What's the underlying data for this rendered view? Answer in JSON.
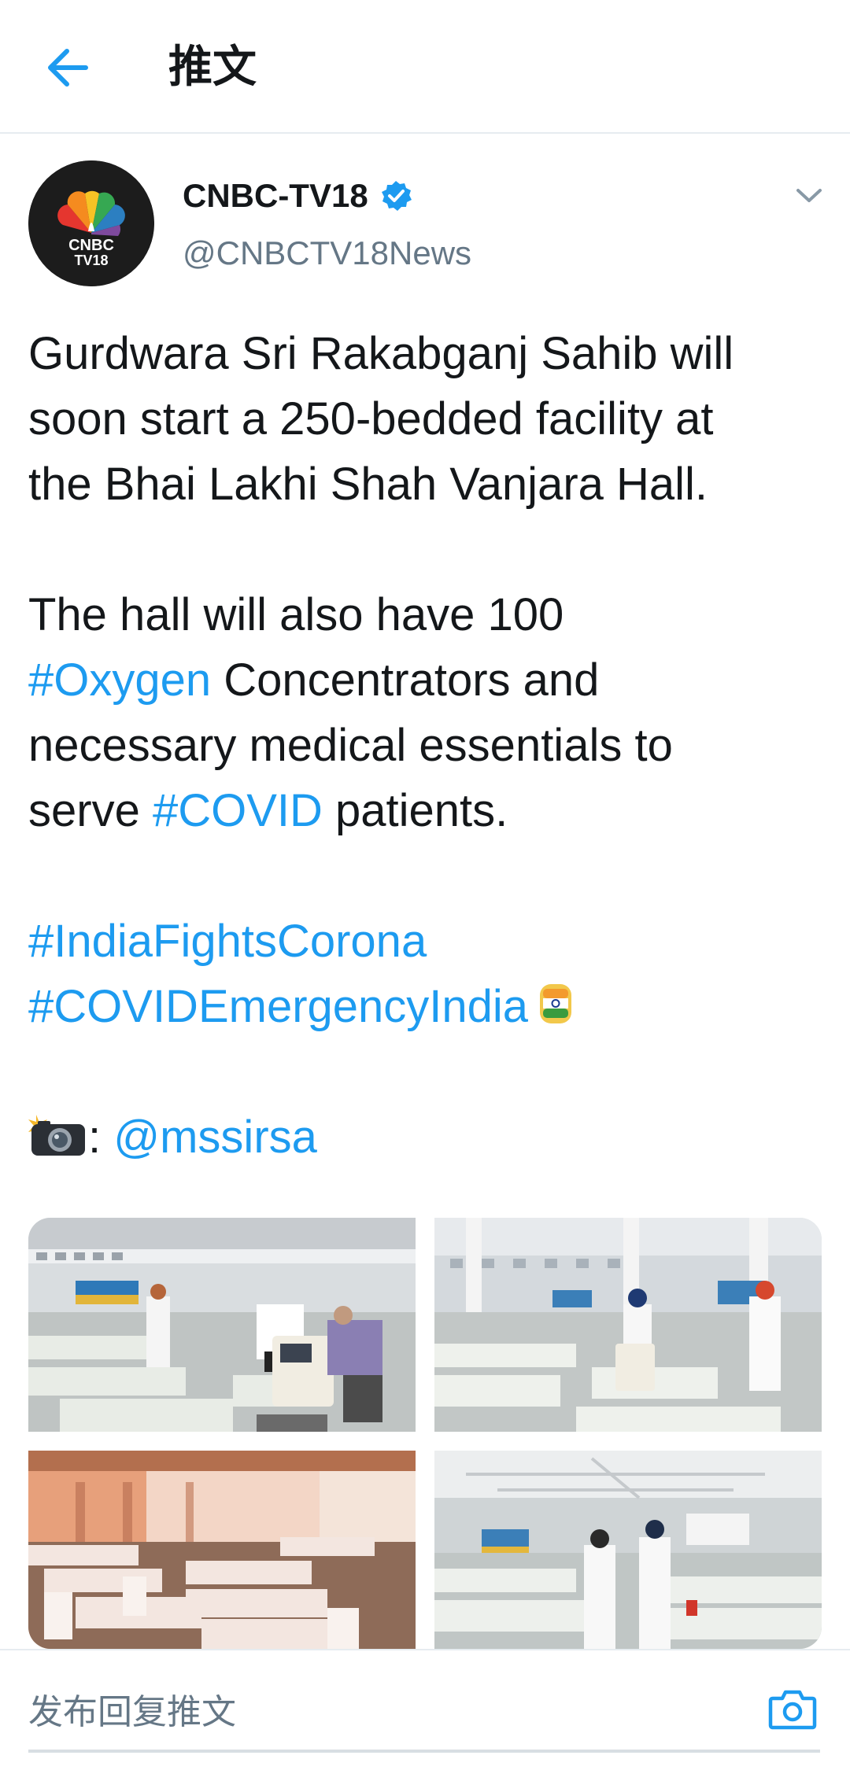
{
  "header": {
    "title": "推文"
  },
  "author": {
    "avatar_text_top": "CNBC",
    "avatar_text_bottom": "TV18",
    "name": "CNBC-TV18",
    "handle": "@CNBCTV18News",
    "verified": true
  },
  "tweet": {
    "lines": [
      "Gurdwara Sri Rakabganj Sahib will",
      "soon start a 250-bedded facility at",
      "the Bhai Lakhi Shah Vanjara Hall."
    ],
    "p2_line1": "The hall will also have 100",
    "p2_hashtag_oxygen": "#Oxygen",
    "p2_line2_rest": " Concentrators and",
    "p2_line3": "necessary medical essentials to",
    "p2_line4_pre": "serve ",
    "p2_hashtag_covid": "#COVID",
    "p2_line4_post": " patients.",
    "hashtag_india_fights": "#IndiaFightsCorona",
    "hashtag_emergency": "#COVIDEmergencyIndia",
    "photo_credit_sep": ": ",
    "photo_credit_mention": "@mssirsa"
  },
  "media": {
    "photos": [
      {
        "icon": "photo-hall-oxygen-concentrator"
      },
      {
        "icon": "photo-hall-volunteers"
      },
      {
        "icon": "photo-hall-beds-warm-light"
      },
      {
        "icon": "photo-hall-two-men-walking"
      }
    ]
  },
  "reply": {
    "placeholder": "发布回复推文"
  },
  "colors": {
    "link": "#1d9bf0",
    "text": "#14171a",
    "muted": "#657786",
    "divider": "#e6ecf0"
  }
}
